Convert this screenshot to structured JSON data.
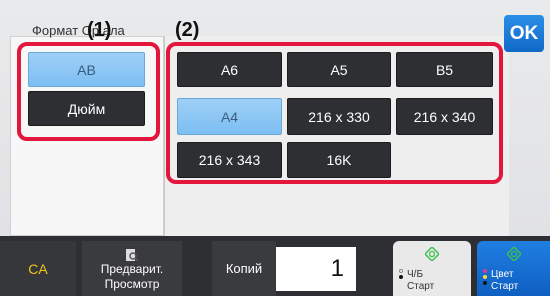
{
  "title_text": "Формат Ор     ала",
  "ok_label": "OK",
  "callouts": {
    "left": "(1)",
    "right": "(2)"
  },
  "left_buttons": [
    {
      "label": "AB",
      "selected": true
    },
    {
      "label": "Дюйм",
      "selected": false
    }
  ],
  "size_buttons": [
    {
      "label": "A6",
      "selected": false
    },
    {
      "label": "A5",
      "selected": false
    },
    {
      "label": "B5",
      "selected": false
    },
    {
      "label": "A4",
      "selected": true
    },
    {
      "label": "216 x 330",
      "selected": false
    },
    {
      "label": "216 x 340",
      "selected": false
    },
    {
      "label": "216 x 343",
      "selected": false
    },
    {
      "label": "16K",
      "selected": false
    }
  ],
  "bottom": {
    "ca_label": "CA",
    "preview_line1": "Предварит.",
    "preview_line2": "Просмотр",
    "copies_label": "Копий",
    "copies_value": "1",
    "bw_line1": "Ч/Б",
    "bw_line2": "Старт",
    "color_line1": "Цвет",
    "color_line2": "Старт"
  },
  "colors": {
    "accent_red": "#e3163b",
    "selected_blue": "#7cbef2",
    "start_blue": "#1168c7",
    "start_icon_green": "#3fbf4f",
    "ca_yellow": "#f0c419"
  }
}
